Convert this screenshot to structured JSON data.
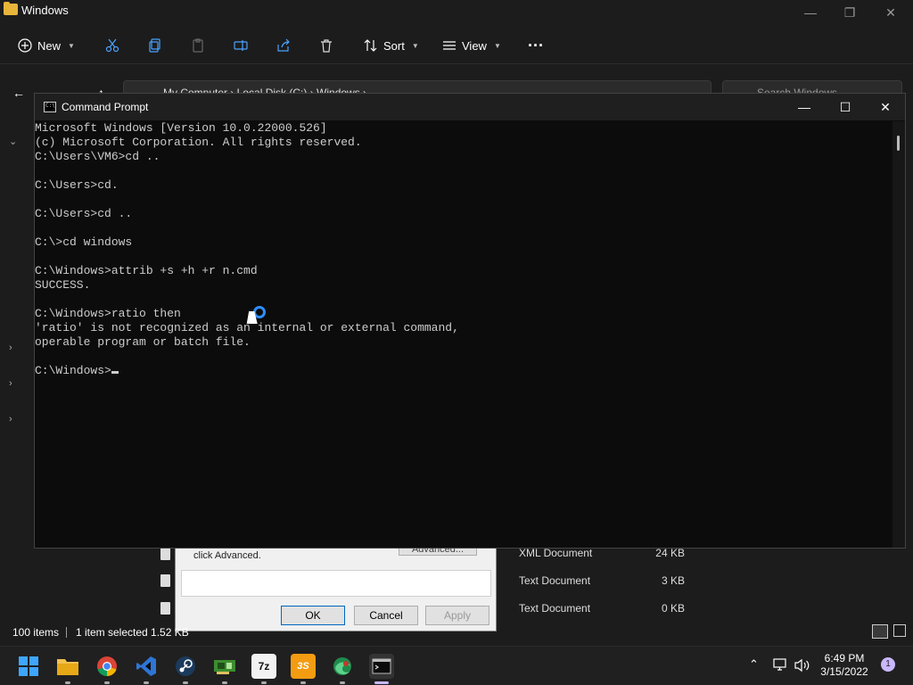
{
  "explorer": {
    "title": "Windows",
    "toolbar": {
      "new_label": "New",
      "sort_label": "Sort",
      "view_label": "View",
      "more_label": "···"
    },
    "address": {
      "path": "My Computer  ›  Local Disk (C:)  ›  Windows  ›",
      "search_placeholder": "Search Windows"
    },
    "files": [
      {
        "type": "XML Document",
        "size": "24 KB"
      },
      {
        "type": "Text Document",
        "size": "3 KB"
      },
      {
        "type": "Text Document",
        "size": "0 KB"
      }
    ],
    "status": {
      "count": "100 items",
      "selected": "1 item selected  1.52 KB"
    }
  },
  "properties": {
    "desc": "click Advanced.",
    "advanced_label": "Advanced...",
    "ok_label": "OK",
    "cancel_label": "Cancel",
    "apply_label": "Apply"
  },
  "cmd": {
    "title": "Command Prompt",
    "lines": [
      "Microsoft Windows [Version 10.0.22000.526]",
      "(c) Microsoft Corporation. All rights reserved.",
      "C:\\Users\\VM6>cd ..",
      "",
      "C:\\Users>cd.",
      "",
      "C:\\Users>cd ..",
      "",
      "C:\\>cd windows",
      "",
      "C:\\Windows>attrib +s +h +r n.cmd",
      "SUCCESS.",
      "",
      "C:\\Windows>ratio then",
      "'ratio' is not recognized as an internal or external command,",
      "operable program or batch file.",
      ""
    ],
    "prompt": "C:\\Windows>"
  },
  "taskbar": {
    "time": "6:49 PM",
    "date": "3/15/2022",
    "notifications": "1",
    "apps": [
      "start",
      "file-explorer",
      "chrome",
      "visual-studio",
      "steam",
      "gpu-z",
      "7zip",
      "3dmark",
      "edge-dev",
      "command-prompt"
    ]
  }
}
